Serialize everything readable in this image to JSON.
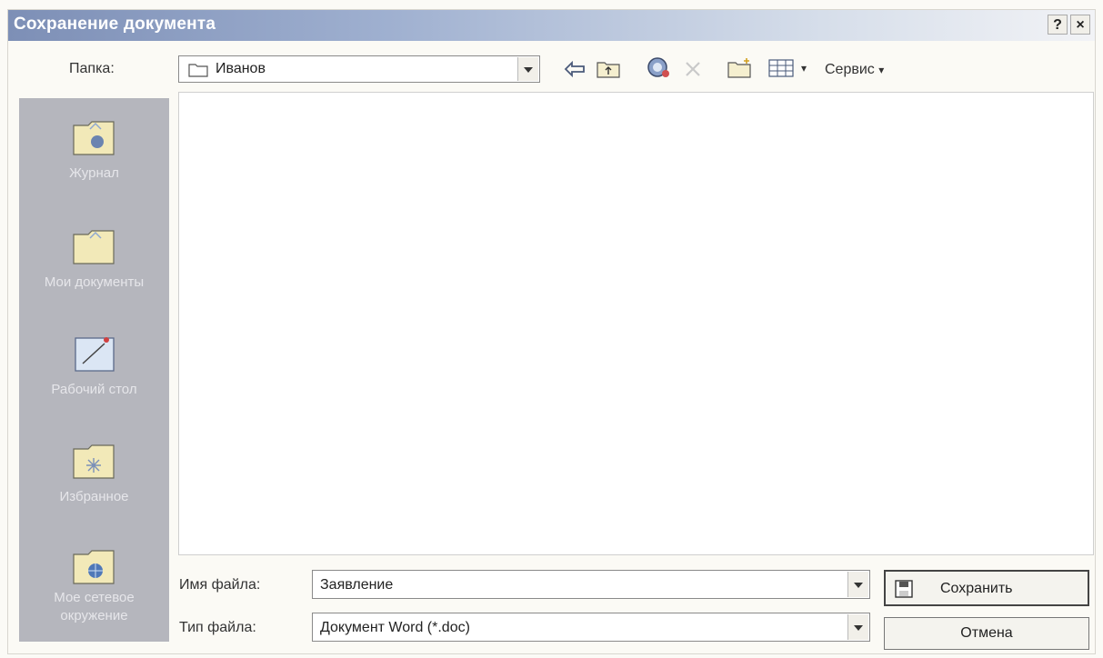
{
  "dialog": {
    "title": "Сохранение документа",
    "help_label": "?",
    "close_label": "×"
  },
  "toolbar": {
    "folder_label": "Папка:",
    "folder_value": "Иванов",
    "service_label": "Сервис",
    "service_arrow": "▾",
    "views_arrow": "▾"
  },
  "places": [
    {
      "label": "Журнал",
      "icon": "history-folder-icon"
    },
    {
      "label": "Мои документы",
      "icon": "my-documents-folder-icon"
    },
    {
      "label": "Рабочий стол",
      "icon": "desktop-icon"
    },
    {
      "label": "Избранное",
      "icon": "favorites-folder-icon"
    },
    {
      "label": "Мое сетевое окружение",
      "icon": "network-folder-icon"
    }
  ],
  "form": {
    "filename_label": "Имя файла:",
    "filename_value": "Заявление",
    "filetype_label": "Тип файла:",
    "filetype_value": "Документ Word (*.doc)"
  },
  "buttons": {
    "save": "Сохранить",
    "cancel": "Отмена"
  },
  "colors": {
    "titlebar_start": "#7d8fb6",
    "places_bg": "#b5b6bd"
  }
}
